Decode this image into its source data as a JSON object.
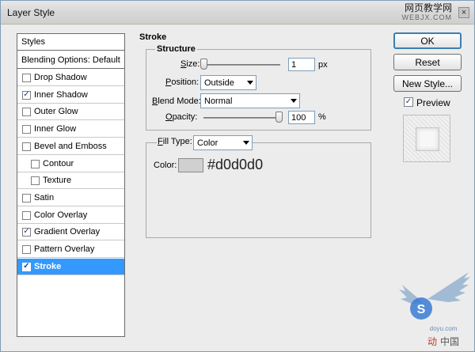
{
  "window": {
    "title": "Layer Style",
    "watermark_top": "网页教学网",
    "watermark_sub": "WEBJX.COM",
    "close_glyph": "×"
  },
  "styles": {
    "header": "Styles",
    "blending": "Blending Options: Default",
    "items": [
      {
        "label": "Drop Shadow",
        "checked": false,
        "sub": false,
        "selected": false
      },
      {
        "label": "Inner Shadow",
        "checked": true,
        "sub": false,
        "selected": false
      },
      {
        "label": "Outer Glow",
        "checked": false,
        "sub": false,
        "selected": false
      },
      {
        "label": "Inner Glow",
        "checked": false,
        "sub": false,
        "selected": false
      },
      {
        "label": "Bevel and Emboss",
        "checked": false,
        "sub": false,
        "selected": false
      },
      {
        "label": "Contour",
        "checked": false,
        "sub": true,
        "selected": false
      },
      {
        "label": "Texture",
        "checked": false,
        "sub": true,
        "selected": false
      },
      {
        "label": "Satin",
        "checked": false,
        "sub": false,
        "selected": false
      },
      {
        "label": "Color Overlay",
        "checked": false,
        "sub": false,
        "selected": false
      },
      {
        "label": "Gradient Overlay",
        "checked": true,
        "sub": false,
        "selected": false
      },
      {
        "label": "Pattern Overlay",
        "checked": false,
        "sub": false,
        "selected": false
      },
      {
        "label": "Stroke",
        "checked": true,
        "sub": false,
        "selected": true
      }
    ]
  },
  "stroke": {
    "group_title": "Stroke",
    "structure_title": "Structure",
    "size_label_u": "S",
    "size_label_rest": "ize:",
    "size_value": "1",
    "size_unit": "px",
    "size_slider_fraction": 0.0,
    "position_label_u": "P",
    "position_label_rest": "osition:",
    "position_value": "Outside",
    "blend_label_u": "B",
    "blend_label_rest": "lend Mode:",
    "blend_value": "Normal",
    "opacity_label_u": "O",
    "opacity_label_rest": "pacity:",
    "opacity_value": "100",
    "opacity_unit": "%",
    "opacity_slider_fraction": 1.0,
    "fill_type_label_u": "F",
    "fill_type_label_rest": "ill Type:",
    "fill_type_value": "Color",
    "color_label": "Color:",
    "color_swatch": "#d0d0d0",
    "color_hex_text": "#d0d0d0"
  },
  "buttons": {
    "ok": "OK",
    "reset": "Reset",
    "new_style": "New Style...",
    "preview_label": "Preview",
    "preview_checked": true
  },
  "logo": {
    "site": "doyu.com",
    "text_cn": "中国",
    "text_cn_prefix": "动"
  },
  "colors": {
    "selection": "#3399ff",
    "focus_border": "#3c7fb1"
  }
}
